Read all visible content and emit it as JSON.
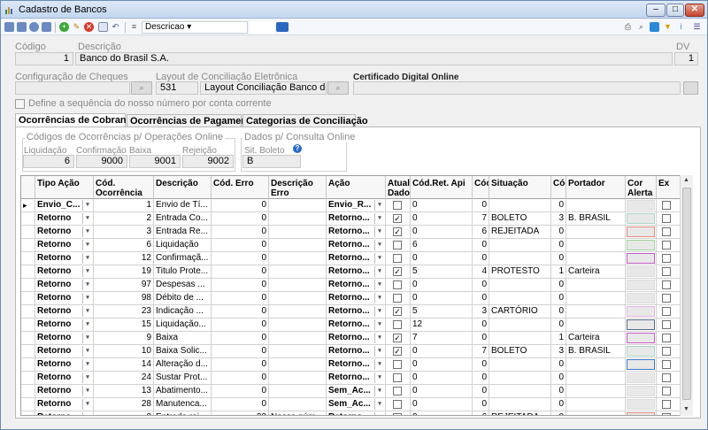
{
  "window": {
    "title": "Cadastro de Bancos",
    "min": "–",
    "max": "□",
    "close": "✕"
  },
  "toolbar": {
    "search_field": "Descricao"
  },
  "header": {
    "codigo_label": "Código",
    "codigo_value": "1",
    "descricao_label": "Descrição",
    "descricao_value": "Banco do Brasil S.A.",
    "dv_label": "DV",
    "dv_value": "1",
    "config_cheques_label": "Configuração de Cheques",
    "layout_label": "Layout de Conciliação Eletrônica",
    "layout_code": "531",
    "layout_name": "Layout Conciliação Banco do B",
    "cert_label": "Certificado Digital Online",
    "define_seq_label": "Define a sequência do nosso número por conta corrente"
  },
  "tabs": [
    "Ocorrências de Cobrança",
    "Ocorrências de Pagamento",
    "Categorias de Conciliação"
  ],
  "online_box": {
    "title": "Códigos de Ocorrências p/ Operações Online",
    "liq_label": "Liquidação",
    "liq_value": "6",
    "conf_label": "Confirmação",
    "conf_value": "9000",
    "baixa_label": "Baixa",
    "baixa_value": "9001",
    "rej_label": "Rejeição",
    "rej_value": "9002"
  },
  "consulta_box": {
    "title": "Dados p/ Consulta Online",
    "sit_label": "Sit. Boleto",
    "sit_value": "B"
  },
  "grid": {
    "headers": [
      "Tipo Ação",
      "Cód. Ocorrência",
      "Descrição",
      "Cód. Erro",
      "Descrição Erro",
      "Ação",
      "Atual Dado",
      "Cód.Ret. Api",
      "Cóc",
      "Situação",
      "Cóc",
      "Portador",
      "Cor Alerta",
      "Ex"
    ],
    "rows": [
      {
        "tipo": "Envio_C...",
        "cod": "1",
        "desc": "Envio de Tí...",
        "erro": "0",
        "desc_erro": "",
        "acao": "Envio_R...",
        "atual": false,
        "ret": "0",
        "c1": "0",
        "sit": "",
        "c2": "0",
        "port": "",
        "cor": "#dcdcdc"
      },
      {
        "tipo": "Retorno",
        "cod": "2",
        "desc": "Entrada Co...",
        "erro": "0",
        "desc_erro": "",
        "acao": "Retorno...",
        "atual": true,
        "ret": "0",
        "c1": "7",
        "sit": "BOLETO",
        "c2": "3",
        "port": "B. BRASIL",
        "cor": "#a8d8c8"
      },
      {
        "tipo": "Retorno",
        "cod": "3",
        "desc": "Entrada Re...",
        "erro": "0",
        "desc_erro": "",
        "acao": "Retorno...",
        "atual": true,
        "ret": "0",
        "c1": "6",
        "sit": "REJEITADA",
        "c2": "0",
        "port": "",
        "cor": "#e88a7a"
      },
      {
        "tipo": "Retorno",
        "cod": "6",
        "desc": "Liquidação",
        "erro": "0",
        "desc_erro": "",
        "acao": "Retorno...",
        "atual": false,
        "ret": "6",
        "c1": "0",
        "sit": "",
        "c2": "0",
        "port": "",
        "cor": "#9ad89a"
      },
      {
        "tipo": "Retorno",
        "cod": "12",
        "desc": "Confirmaçã...",
        "erro": "0",
        "desc_erro": "",
        "acao": "Retorno...",
        "atual": false,
        "ret": "0",
        "c1": "0",
        "sit": "",
        "c2": "0",
        "port": "",
        "cor": "#c75ac7"
      },
      {
        "tipo": "Retorno",
        "cod": "19",
        "desc": "Titulo Prote...",
        "erro": "0",
        "desc_erro": "",
        "acao": "Retorno...",
        "atual": true,
        "ret": "5",
        "c1": "4",
        "sit": "PROTESTO",
        "c2": "1",
        "port": "Carteira",
        "cor": "#dcdcdc"
      },
      {
        "tipo": "Retorno",
        "cod": "97",
        "desc": "Despesas ...",
        "erro": "0",
        "desc_erro": "",
        "acao": "Retorno...",
        "atual": false,
        "ret": "0",
        "c1": "0",
        "sit": "",
        "c2": "0",
        "port": "",
        "cor": "#dcdcdc"
      },
      {
        "tipo": "Retorno",
        "cod": "98",
        "desc": "Débito de ...",
        "erro": "0",
        "desc_erro": "",
        "acao": "Retorno...",
        "atual": false,
        "ret": "0",
        "c1": "0",
        "sit": "",
        "c2": "0",
        "port": "",
        "cor": "#dcdcdc"
      },
      {
        "tipo": "Retorno",
        "cod": "23",
        "desc": "Indicação ...",
        "erro": "0",
        "desc_erro": "",
        "acao": "Retorno...",
        "atual": true,
        "ret": "5",
        "c1": "3",
        "sit": "CARTÓRIO",
        "c2": "0",
        "port": "",
        "cor": "#e8b4e8"
      },
      {
        "tipo": "Retorno",
        "cod": "15",
        "desc": "Liquidação...",
        "erro": "0",
        "desc_erro": "",
        "acao": "Retorno...",
        "atual": false,
        "ret": "12",
        "c1": "0",
        "sit": "",
        "c2": "0",
        "port": "",
        "cor": "#5a6e8a"
      },
      {
        "tipo": "Retorno",
        "cod": "9",
        "desc": "Baixa",
        "erro": "0",
        "desc_erro": "",
        "acao": "Retorno...",
        "atual": true,
        "ret": "7",
        "c1": "0",
        "sit": "",
        "c2": "1",
        "port": "Carteira",
        "cor": "#c75ac7"
      },
      {
        "tipo": "Retorno",
        "cod": "10",
        "desc": "Baixa Solic...",
        "erro": "0",
        "desc_erro": "",
        "acao": "Retorno...",
        "atual": true,
        "ret": "0",
        "c1": "7",
        "sit": "BOLETO",
        "c2": "3",
        "port": "B. BRASIL",
        "cor": "#a8d8c8"
      },
      {
        "tipo": "Retorno",
        "cod": "14",
        "desc": "Alteração d...",
        "erro": "0",
        "desc_erro": "",
        "acao": "Retorno...",
        "atual": false,
        "ret": "0",
        "c1": "0",
        "sit": "",
        "c2": "0",
        "port": "",
        "cor": "#3a7ac8"
      },
      {
        "tipo": "Retorno",
        "cod": "24",
        "desc": "Sustar Prot...",
        "erro": "0",
        "desc_erro": "",
        "acao": "Retorno...",
        "atual": false,
        "ret": "0",
        "c1": "0",
        "sit": "",
        "c2": "0",
        "port": "",
        "cor": "#dcdcdc"
      },
      {
        "tipo": "Retorno",
        "cod": "13",
        "desc": "Abatimento...",
        "erro": "0",
        "desc_erro": "",
        "acao": "Sem_Ac...",
        "atual": false,
        "ret": "0",
        "c1": "0",
        "sit": "",
        "c2": "0",
        "port": "",
        "cor": "#dcdcdc"
      },
      {
        "tipo": "Retorno",
        "cod": "28",
        "desc": "Manutenca...",
        "erro": "0",
        "desc_erro": "",
        "acao": "Sem_Ac...",
        "atual": false,
        "ret": "0",
        "c1": "0",
        "sit": "",
        "c2": "0",
        "port": "",
        "cor": "#dcdcdc"
      },
      {
        "tipo": "Retorno",
        "cod": "3",
        "desc": "Entrada rej...",
        "erro": "33",
        "desc_erro": "Nosso núm...",
        "acao": "Retorno...",
        "atual": true,
        "ret": "0",
        "c1": "6",
        "sit": "REJEITADA",
        "c2": "0",
        "port": "",
        "cor": "#e88a7a"
      }
    ]
  }
}
